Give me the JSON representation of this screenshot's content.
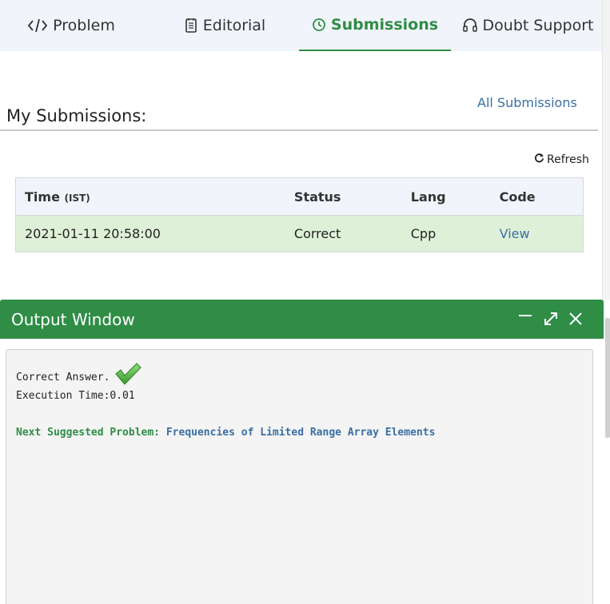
{
  "tabs": [
    {
      "label": "Problem",
      "icon": "code-icon",
      "active": false
    },
    {
      "label": "Editorial",
      "icon": "document-icon",
      "active": false
    },
    {
      "label": "Submissions",
      "icon": "clock-icon",
      "active": true
    },
    {
      "label": "Doubt Support",
      "icon": "headset-icon",
      "active": false
    }
  ],
  "submissions": {
    "title": "My Submissions:",
    "all_link": "All Submissions",
    "refresh_label": "Refresh",
    "headers": {
      "time": "Time",
      "time_unit": "(IST)",
      "status": "Status",
      "lang": "Lang",
      "code": "Code"
    },
    "rows": [
      {
        "time": "2021-01-11 20:58:00",
        "status": "Correct",
        "lang": "Cpp",
        "code": "View"
      }
    ]
  },
  "output": {
    "title": "Output Window",
    "result": "Correct Answer.",
    "exec_time": "Execution Time:0.01",
    "suggest_label": "Next Suggested Problem:",
    "suggest_link": "Frequencies of Limited Range Array Elements"
  },
  "colors": {
    "accent": "#2f8d46",
    "link": "#3a6fa3",
    "row_success": "#dff0d8",
    "tab_bg": "#f1f4fa"
  }
}
